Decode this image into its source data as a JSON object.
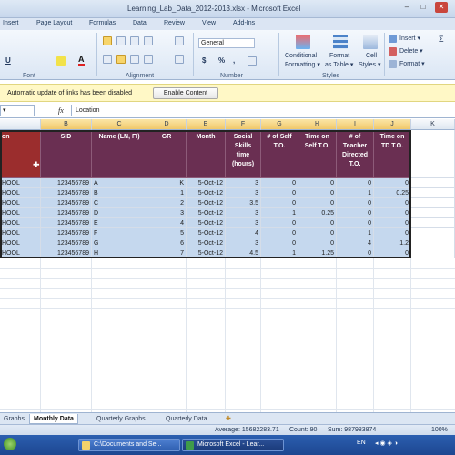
{
  "window": {
    "title": "Learning_Lab_Data_2012-2013.xlsx  -  Microsoft Excel",
    "minimize": "–",
    "maximize": "□",
    "close": "✕"
  },
  "ribbon": {
    "tabs": [
      "Insert",
      "Page Layout",
      "Formulas",
      "Data",
      "Review",
      "View",
      "Add-Ins"
    ],
    "font_size_combo": "General",
    "groups": {
      "font": "Font",
      "alignment": "Alignment",
      "number": "Number",
      "styles": "Styles"
    },
    "buttons": {
      "underline": "U",
      "font_color": "A",
      "currency": "$",
      "percent": "%",
      "comma": ",",
      "conditional": "Conditional",
      "conditional2": "Formatting ▾",
      "format_table": "Format",
      "format_table2": "as Table ▾",
      "cell_styles": "Cell",
      "cell_styles2": "Styles ▾",
      "insert": "Insert ▾",
      "delete": "Delete ▾",
      "format": "Format ▾"
    }
  },
  "message_bar": {
    "text": "Automatic update of links has been disabled",
    "button": "Enable Content"
  },
  "formula_bar": {
    "fx": "fx",
    "content": "Location"
  },
  "columns": [
    "",
    "B",
    "C",
    "D",
    "E",
    "F",
    "G",
    "H",
    "I",
    "J",
    "K"
  ],
  "headers": [
    "on",
    "SID",
    "Name (LN, FI)",
    "GR",
    "Month",
    "Social Skills time (hours)",
    "# of Self T.O.",
    "Time on Self T.O.",
    "# of Teacher Directed T.O.",
    "Time on TD T.O."
  ],
  "rows": [
    [
      "HOOL",
      "123456789",
      "A",
      "K",
      "5-Oct-12",
      "3",
      "0",
      "0",
      "0",
      "0"
    ],
    [
      "HOOL",
      "123456789",
      "B",
      "1",
      "5-Oct-12",
      "3",
      "0",
      "0",
      "1",
      "0.25"
    ],
    [
      "HOOL",
      "123456789",
      "C",
      "2",
      "5-Oct-12",
      "3.5",
      "0",
      "0",
      "0",
      "0"
    ],
    [
      "HOOL",
      "123456789",
      "D",
      "3",
      "5-Oct-12",
      "3",
      "1",
      "0.25",
      "0",
      "0"
    ],
    [
      "HOOL",
      "123456789",
      "E",
      "4",
      "5-Oct-12",
      "3",
      "0",
      "0",
      "0",
      "0"
    ],
    [
      "HOOL",
      "123456789",
      "F",
      "5",
      "5-Oct-12",
      "4",
      "0",
      "0",
      "1",
      "0"
    ],
    [
      "HOOL",
      "123456789",
      "G",
      "6",
      "5-Oct-12",
      "3",
      "0",
      "0",
      "4",
      "1.2"
    ],
    [
      "HOOL",
      "123456789",
      "H",
      "7",
      "5-Oct-12",
      "4.5",
      "1",
      "1.25",
      "0",
      "0"
    ]
  ],
  "sheet_tabs": [
    "Graphs",
    "Monthly Data",
    "Quarterly Graphs",
    "Quarterly Data"
  ],
  "status": {
    "average": "Average: 15682283.71",
    "count": "Count: 90",
    "sum": "Sum: 987983874",
    "zoom": "100%"
  },
  "taskbar": {
    "tasks": [
      "C:\\Documents and Se...",
      "Microsoft Excel - Lear..."
    ],
    "lang": "EN"
  },
  "colors": {
    "header_bg": "#6a2f52",
    "first_header_bg": "#9b2d2d",
    "data_bg": "#c5d8ee"
  }
}
